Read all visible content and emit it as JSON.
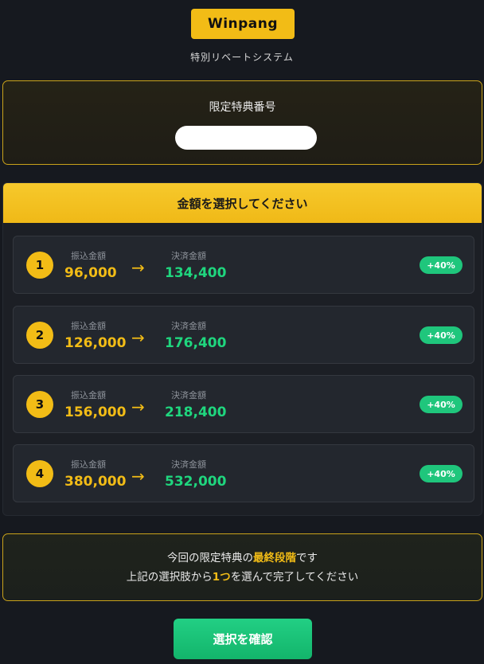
{
  "brand": {
    "name": "Winpang",
    "subtitle": "特別リベートシステム"
  },
  "code_box": {
    "label": "限定特典番号"
  },
  "selection": {
    "header": "金額を選択してください",
    "from_label": "振込金額",
    "to_label": "決済金額",
    "arrow": "→",
    "options": [
      {
        "num": "1",
        "from": "96,000",
        "to": "134,400",
        "badge": "+40%"
      },
      {
        "num": "2",
        "from": "126,000",
        "to": "176,400",
        "badge": "+40%"
      },
      {
        "num": "3",
        "from": "156,000",
        "to": "218,400",
        "badge": "+40%"
      },
      {
        "num": "4",
        "from": "380,000",
        "to": "532,000",
        "badge": "+40%"
      }
    ]
  },
  "notice": {
    "line1_a": "今回の限定特典の",
    "line1_hl": "最終段階",
    "line1_b": "です",
    "line2_a": "上記の選択肢から",
    "line2_hl": "1つ",
    "line2_b": "を選んで完了してください"
  },
  "confirm_button": "選択を確認",
  "colors": {
    "accent": "#f2bc16",
    "success": "#1fc67c",
    "background": "#16191f"
  }
}
